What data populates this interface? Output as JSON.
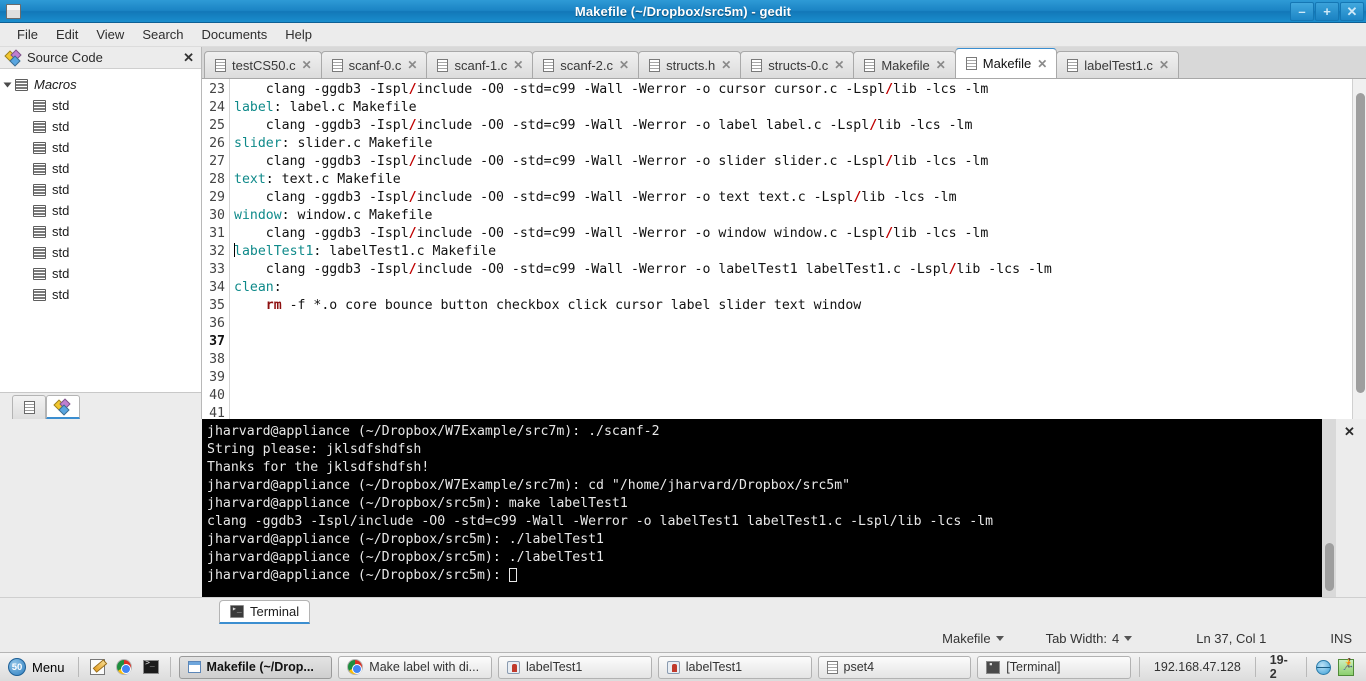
{
  "window": {
    "title": "Makefile (~/Dropbox/src5m) - gedit",
    "icon": "window-icon",
    "controls": [
      {
        "name": "minimize-button",
        "glyph": "–"
      },
      {
        "name": "maximize-button",
        "glyph": "+"
      },
      {
        "name": "close-button",
        "glyph": "✕"
      }
    ]
  },
  "menubar": {
    "items": [
      "File",
      "Edit",
      "View",
      "Search",
      "Documents",
      "Help"
    ]
  },
  "sidebar": {
    "title": "Source Code",
    "close_label": "✕",
    "tree": {
      "root_label": "Macros",
      "children": [
        "std",
        "std",
        "std",
        "std",
        "std",
        "std",
        "std",
        "std",
        "std",
        "std"
      ]
    },
    "footer_tabs": [
      "documents-tab",
      "source-code-tab"
    ]
  },
  "tabs": [
    {
      "label": "testCS50.c",
      "active": false
    },
    {
      "label": "scanf-0.c",
      "active": false
    },
    {
      "label": "scanf-1.c",
      "active": false
    },
    {
      "label": "scanf-2.c",
      "active": false
    },
    {
      "label": "structs.h",
      "active": false
    },
    {
      "label": "structs-0.c",
      "active": false
    },
    {
      "label": "Makefile",
      "active": false
    },
    {
      "label": "Makefile",
      "active": true
    },
    {
      "label": "labelTest1.c",
      "active": false
    }
  ],
  "editor": {
    "first_line": 23,
    "cursor_line": 37,
    "lines": [
      {
        "n": 23,
        "segments": [
          {
            "t": "    clang -ggdb3 -Ispl"
          },
          {
            "t": "/",
            "c": "sl"
          },
          {
            "t": "include -O0 -std=c99 -Wall -Werror -o cursor cursor.c -Lspl"
          },
          {
            "t": "/",
            "c": "sl"
          },
          {
            "t": "lib -lcs -lm"
          }
        ]
      },
      {
        "n": 24,
        "segments": [
          {
            "t": ""
          }
        ]
      },
      {
        "n": 25,
        "segments": [
          {
            "t": "label",
            "c": "tgt"
          },
          {
            "t": ": label.c Makefile"
          }
        ]
      },
      {
        "n": 26,
        "segments": [
          {
            "t": "    clang -ggdb3 -Ispl"
          },
          {
            "t": "/",
            "c": "sl"
          },
          {
            "t": "include -O0 -std=c99 -Wall -Werror -o label label.c -Lspl"
          },
          {
            "t": "/",
            "c": "sl"
          },
          {
            "t": "lib -lcs -lm"
          }
        ]
      },
      {
        "n": 27,
        "segments": [
          {
            "t": ""
          }
        ]
      },
      {
        "n": 28,
        "segments": [
          {
            "t": "slider",
            "c": "tgt"
          },
          {
            "t": ": slider.c Makefile"
          }
        ]
      },
      {
        "n": 29,
        "segments": [
          {
            "t": "    clang -ggdb3 -Ispl"
          },
          {
            "t": "/",
            "c": "sl"
          },
          {
            "t": "include -O0 -std=c99 -Wall -Werror -o slider slider.c -Lspl"
          },
          {
            "t": "/",
            "c": "sl"
          },
          {
            "t": "lib -lcs -lm"
          }
        ]
      },
      {
        "n": 30,
        "segments": [
          {
            "t": ""
          }
        ]
      },
      {
        "n": 31,
        "segments": [
          {
            "t": "text",
            "c": "tgt"
          },
          {
            "t": ": text.c Makefile"
          }
        ]
      },
      {
        "n": 32,
        "segments": [
          {
            "t": "    clang -ggdb3 -Ispl"
          },
          {
            "t": "/",
            "c": "sl"
          },
          {
            "t": "include -O0 -std=c99 -Wall -Werror -o text text.c -Lspl"
          },
          {
            "t": "/",
            "c": "sl"
          },
          {
            "t": "lib -lcs -lm"
          }
        ]
      },
      {
        "n": 33,
        "segments": [
          {
            "t": ""
          }
        ]
      },
      {
        "n": 34,
        "segments": [
          {
            "t": "window",
            "c": "tgt"
          },
          {
            "t": ": window.c Makefile"
          }
        ]
      },
      {
        "n": 35,
        "segments": [
          {
            "t": "    clang -ggdb3 -Ispl"
          },
          {
            "t": "/",
            "c": "sl"
          },
          {
            "t": "include -O0 -std=c99 -Wall -Werror -o window window.c -Lspl"
          },
          {
            "t": "/",
            "c": "sl"
          },
          {
            "t": "lib -lcs -lm"
          }
        ]
      },
      {
        "n": 36,
        "segments": [
          {
            "t": ""
          }
        ]
      },
      {
        "n": 37,
        "segments": [
          {
            "caret": true
          },
          {
            "t": "labelTest1",
            "c": "tgt"
          },
          {
            "t": ": labelTest1.c Makefile"
          }
        ]
      },
      {
        "n": 38,
        "segments": [
          {
            "t": "    clang -ggdb3 -Ispl"
          },
          {
            "t": "/",
            "c": "sl"
          },
          {
            "t": "include -O0 -std=c99 -Wall -Werror -o labelTest1 labelTest1.c -Lspl"
          },
          {
            "t": "/",
            "c": "sl"
          },
          {
            "t": "lib -lcs -lm"
          }
        ]
      },
      {
        "n": 39,
        "segments": [
          {
            "t": ""
          }
        ]
      },
      {
        "n": 40,
        "segments": [
          {
            "t": "clean",
            "c": "tgt"
          },
          {
            "t": ":"
          }
        ]
      },
      {
        "n": 41,
        "segments": [
          {
            "t": "    "
          },
          {
            "t": "rm",
            "c": "rm"
          },
          {
            "t": " -f *.o core bounce button checkbox click cursor label slider text window"
          }
        ]
      }
    ]
  },
  "terminal": {
    "close_label": "✕",
    "lines": [
      "jharvard@appliance (~/Dropbox/W7Example/src7m): ./scanf-2",
      "String please: jklsdfshdfsh",
      "Thanks for the jklsdfshdfsh!",
      "jharvard@appliance (~/Dropbox/W7Example/src7m): cd \"/home/jharvard/Dropbox/src5m\"",
      "jharvard@appliance (~/Dropbox/src5m): make labelTest1",
      "clang -ggdb3 -Ispl/include -O0 -std=c99 -Wall -Werror -o labelTest1 labelTest1.c -Lspl/lib -lcs -lm",
      "jharvard@appliance (~/Dropbox/src5m): ./labelTest1",
      "jharvard@appliance (~/Dropbox/src5m): ./labelTest1"
    ],
    "prompt": "jharvard@appliance (~/Dropbox/src5m): "
  },
  "bottom_panel": {
    "tab_label": "Terminal"
  },
  "statusbar": {
    "language": "Makefile",
    "tab_width_label": "Tab Width:",
    "tab_width_value": "4",
    "position": "Ln 37, Col 1",
    "insert_mode": "INS"
  },
  "taskbar": {
    "menu_badge": "50",
    "menu_label": "Menu",
    "launchers": [
      "text-editor-icon",
      "chrome-icon",
      "terminal-icon"
    ],
    "tasks": [
      {
        "label": "Makefile (~/Drop...",
        "icon": "window-icon",
        "active": true
      },
      {
        "label": "Make label with di...",
        "icon": "chrome-icon",
        "active": false
      },
      {
        "label": "labelTest1",
        "icon": "java-icon",
        "active": false
      },
      {
        "label": "labelTest1",
        "icon": "java-icon",
        "active": false
      },
      {
        "label": "pset4",
        "icon": "document-icon",
        "active": false
      },
      {
        "label": "[Terminal]",
        "icon": "terminal-icon",
        "active": false
      }
    ],
    "tray": {
      "ip": "192.168.47.128",
      "workspace": "19-2",
      "icons": [
        "network-icon",
        "run-icon"
      ]
    }
  },
  "colors": {
    "titlebar": "#1b84c4",
    "accent": "#3b8ed0",
    "target": "#0f8a8a",
    "slash": "#c00000",
    "terminal_bg": "#000000"
  }
}
